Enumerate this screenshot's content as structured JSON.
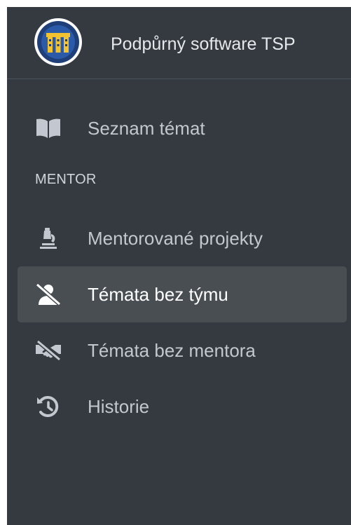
{
  "brand": {
    "logo_icon": "tsp-logo-icon",
    "title": "Podpůrný software TSP"
  },
  "nav": {
    "items_top": [
      {
        "label": "Seznam témat",
        "icon": "book-open-icon",
        "active": false
      }
    ],
    "section_header": "MENTOR",
    "items_mentor": [
      {
        "label": "Mentorované projekty",
        "icon": "microscope-icon",
        "active": false
      },
      {
        "label": "Témata bez týmu",
        "icon": "user-slash-icon",
        "active": true
      },
      {
        "label": "Témata bez mentora",
        "icon": "handshake-slash-icon",
        "active": false
      },
      {
        "label": "Historie",
        "icon": "history-icon",
        "active": false
      }
    ]
  },
  "colors": {
    "sidebar_bg": "#343a40",
    "active_item_bg": "#494e53",
    "text": "#c2c7d0",
    "active_text": "#ffffff"
  }
}
